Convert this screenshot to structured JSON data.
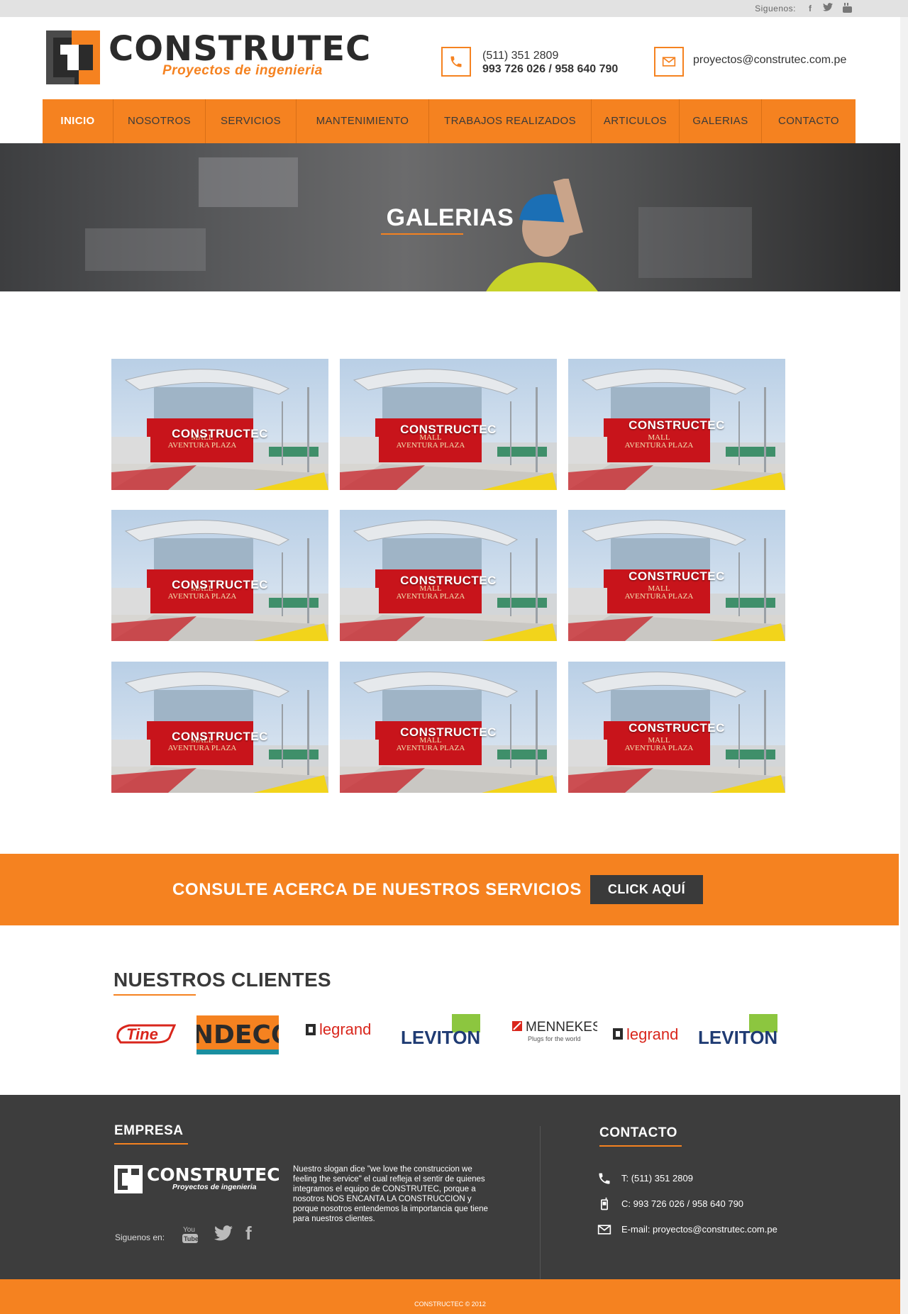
{
  "topbar": {
    "follow_label": "Siguenos:",
    "icons": [
      "facebook-icon",
      "twitter-icon",
      "youtube-icon"
    ]
  },
  "brand": {
    "name": "CONSTRUTEC",
    "tagline": "Proyectos de ingenieria",
    "accent": "#f58220",
    "dark": "#3a3a3a"
  },
  "contact": {
    "phone1": "(511) 351 2809",
    "phone2": "993 726 026 / 958 640 790",
    "email": "proyectos@construtec.com.pe"
  },
  "nav": {
    "items": [
      {
        "label": "INICIO",
        "active": true
      },
      {
        "label": "NOSOTROS"
      },
      {
        "label": "SERVICIOS"
      },
      {
        "label": "MANTENIMIENTO"
      },
      {
        "label": "TRABAJOS REALIZADOS"
      },
      {
        "label": "ARTICULOS"
      },
      {
        "label": "GALERIAS"
      },
      {
        "label": "CONTACTO"
      }
    ]
  },
  "hero": {
    "title": "GALERIAS"
  },
  "gallery": {
    "items": [
      {
        "caption": "CONSTRUCTEC"
      },
      {
        "caption": "CONSTRUCTEC"
      },
      {
        "caption": "CONSTRUCTEC"
      },
      {
        "caption": "CONSTRUCTEC"
      },
      {
        "caption": "CONSTRUCTEC"
      },
      {
        "caption": "CONSTRUCTEC"
      },
      {
        "caption": "CONSTRUCTEC"
      },
      {
        "caption": "CONSTRUCTEC"
      },
      {
        "caption": "CONSTRUCTEC"
      }
    ],
    "sign": {
      "line1": "MALL",
      "line2": "AVENTURA PLAZA"
    }
  },
  "cta": {
    "text": "CONSULTE ACERCA DE NUESTROS SERVICIOS",
    "button": "CLICK AQUÍ"
  },
  "clients": {
    "title": "NUESTROS CLIENTES",
    "logos": [
      "Tine",
      "INDECO",
      "legrand",
      "LEVITON",
      "MENNEKES",
      "legrand",
      "LEVITON"
    ],
    "mennekes_sub": "Plugs for the world"
  },
  "footer": {
    "empresa_title": "EMPRESA",
    "contacto_title": "CONTACTO",
    "description": "Nuestro slogan dice \"we love the construccion we feeling the service\" el cual refleja el sentir de quienes integramos el equipo de CONSTRUTEC, porque a nosotros NOS ENCANTA LA CONSTRUCCION y porque nosotros entendemos la importancia que tiene para nuestros clientes.",
    "follow_label": "Siguenos en:",
    "phone": "T: (511) 351 2809",
    "cell": "C: 993 726 026 / 958 640 790",
    "email": "E-mail: proyectos@construtec.com.pe"
  },
  "copyright": "CONSTRUCTEC © 2012"
}
